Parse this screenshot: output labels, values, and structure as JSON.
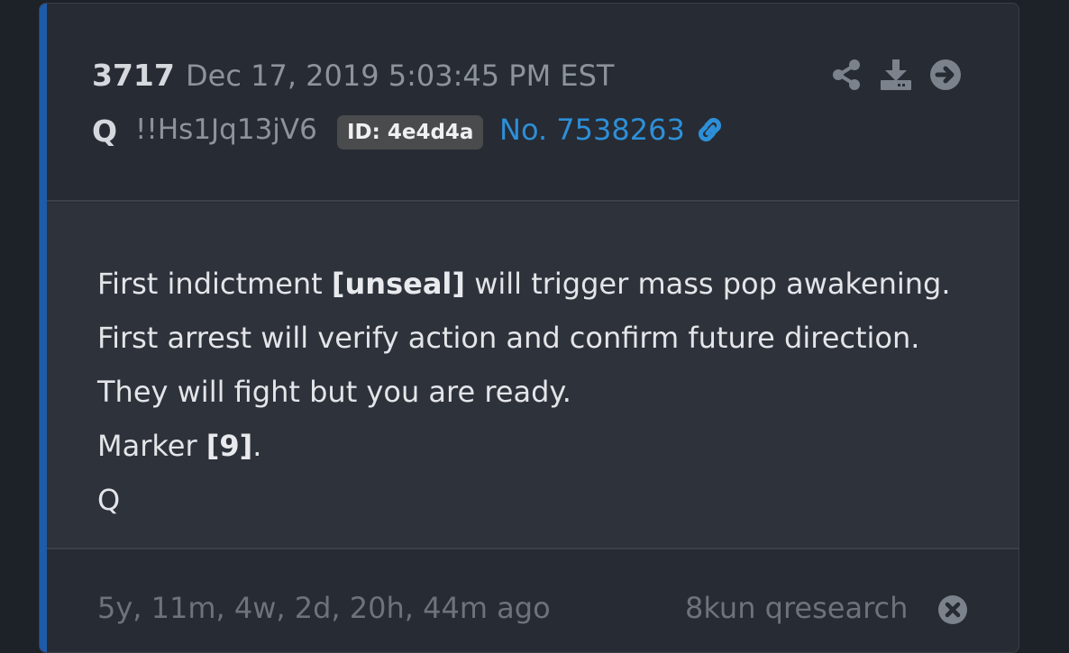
{
  "post": {
    "number": "3717",
    "timestamp": "Dec 17, 2019 5:03:45 PM EST",
    "author": "Q",
    "tripcode": "!!Hs1Jq13jV6",
    "id_badge": "ID: 4e4d4a",
    "post_link": "No. 7538263"
  },
  "message": {
    "line1": {
      "before": "First indictment ",
      "bold": "[unseal]",
      "after": " will trigger mass pop awakening."
    },
    "line2": "First arrest will verify action and confirm future direction.",
    "line3": "They will fight but you are ready.",
    "line4": {
      "before": "Marker ",
      "bold": "[9]",
      "after": "."
    },
    "line5": "Q"
  },
  "footer": {
    "relative_time": "5y, 11m, 4w, 2d, 20h, 44m ago",
    "source": "8kun qresearch"
  },
  "icons": {
    "share": "share-icon",
    "download": "download-icon",
    "go": "arrow-right-circle-icon",
    "link": "link-icon",
    "close": "close-circle-icon"
  },
  "colors": {
    "accent": "#1e5ba8",
    "link": "#2d8fd8",
    "card_background": "#272b33",
    "body_background": "#2e323b"
  }
}
